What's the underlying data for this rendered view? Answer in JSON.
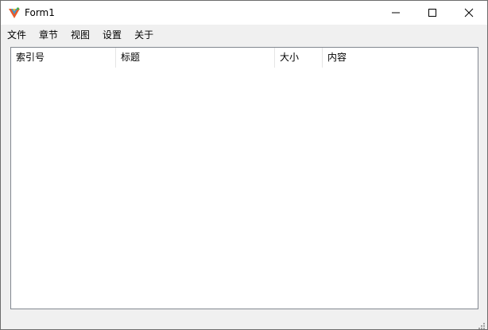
{
  "window": {
    "title": "Form1",
    "icons": {
      "app": "app-logo-icon",
      "minimize": "minimize-icon",
      "maximize": "maximize-icon",
      "close": "close-icon",
      "grip": "size-grip-icon"
    }
  },
  "menu": {
    "items": [
      {
        "label": "文件"
      },
      {
        "label": "章节"
      },
      {
        "label": "视图"
      },
      {
        "label": "设置"
      },
      {
        "label": "关于"
      }
    ]
  },
  "list": {
    "columns": [
      {
        "label": "索引号"
      },
      {
        "label": "标题"
      },
      {
        "label": "大小"
      },
      {
        "label": "内容"
      }
    ],
    "rows": []
  },
  "colors": {
    "titlebar": "#ffffff",
    "chrome": "#f0f0f0",
    "list_border": "#828790"
  }
}
